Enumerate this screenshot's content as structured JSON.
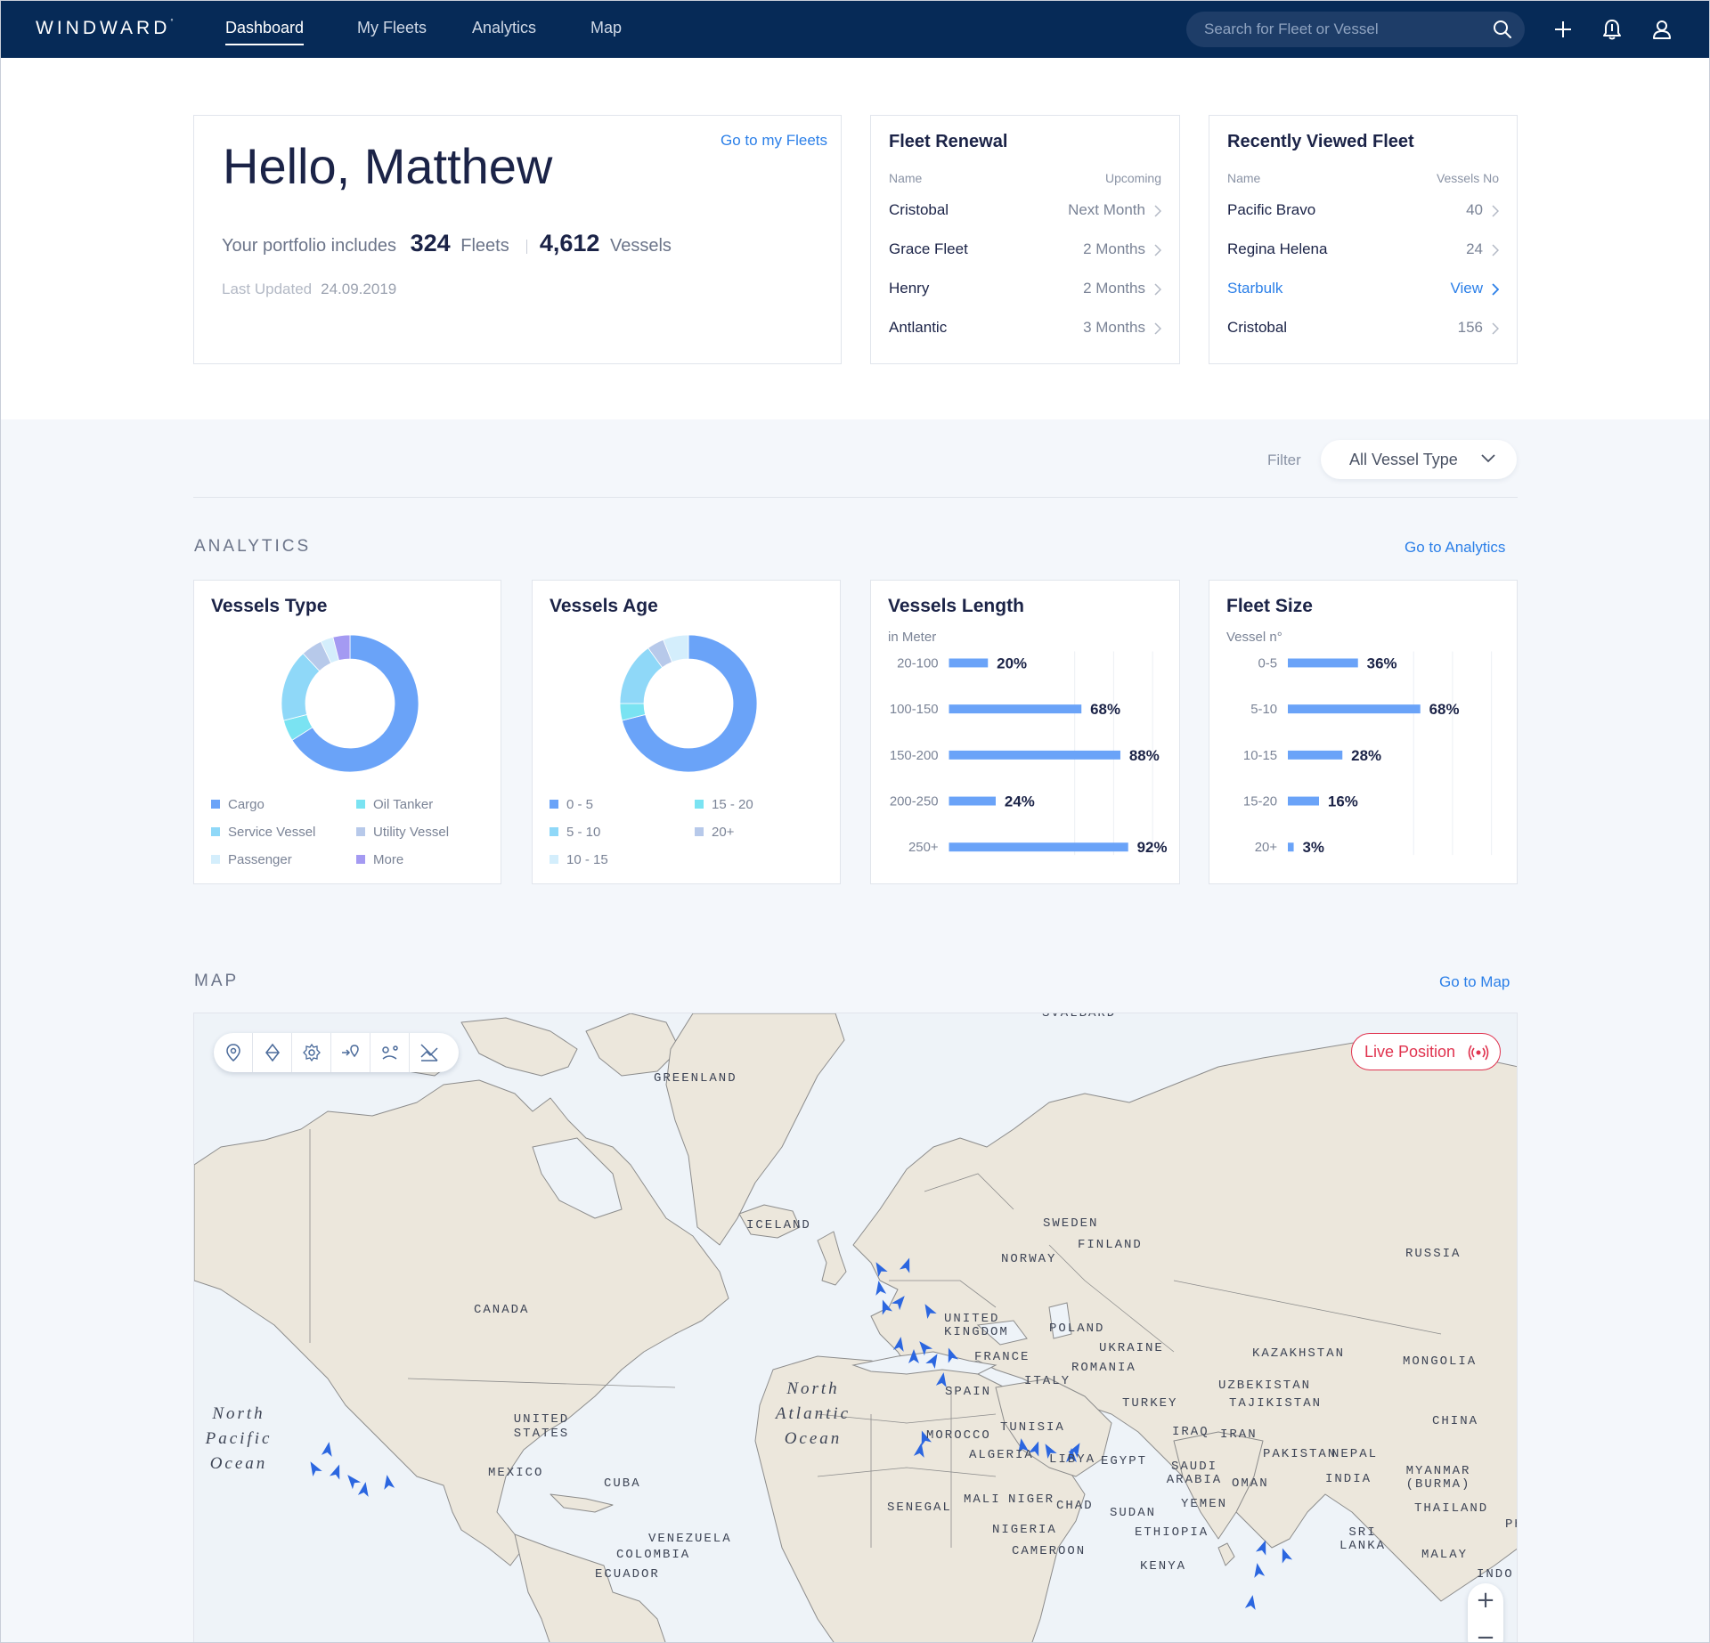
{
  "nav": {
    "brand": "WINDWARD",
    "brand_mark": "°",
    "links": [
      "Dashboard",
      "My Fleets",
      "Analytics",
      "Map"
    ],
    "active": "Dashboard",
    "search_placeholder": "Search for Fleet or Vessel",
    "icons": [
      "search-icon",
      "plus-icon",
      "bell-icon",
      "user-icon"
    ]
  },
  "hello": {
    "greeting": "Hello, Matthew",
    "go_link": "Go to my Fleets",
    "portfolio_prefix": "Your portfolio includes",
    "fleets_count": "324",
    "fleets_label": "Fleets",
    "vessels_count": "4,612",
    "vessels_label": "Vessels",
    "updated_label": "Last Updated",
    "updated_date": "24.09.2019"
  },
  "renewal": {
    "title": "Fleet Renewal",
    "col_name": "Name",
    "col_value": "Upcoming",
    "rows": [
      {
        "name": "Cristobal",
        "value": "Next Month"
      },
      {
        "name": "Grace Fleet",
        "value": "2 Months"
      },
      {
        "name": "Henry",
        "value": "2 Months"
      },
      {
        "name": "Antlantic",
        "value": "3 Months"
      }
    ]
  },
  "recent": {
    "title": "Recently Viewed Fleet",
    "col_name": "Name",
    "col_value": "Vessels No",
    "rows": [
      {
        "name": "Pacific Bravo",
        "value": "40"
      },
      {
        "name": "Regina Helena",
        "value": "24"
      },
      {
        "name": "Starbulk",
        "value": "View"
      },
      {
        "name": "Cristobal",
        "value": "156"
      }
    ]
  },
  "filter": {
    "label": "Filter",
    "value": "All Vessel Type"
  },
  "analytics": {
    "section_title": "ANALYTICS",
    "go_link": "Go to Analytics",
    "vessels_type": {
      "title": "Vessels Type"
    },
    "vessels_age": {
      "title": "Vessels Age"
    },
    "vessels_length": {
      "title": "Vessels Length",
      "subtitle": "in Meter"
    },
    "fleet_size": {
      "title": "Fleet Size",
      "subtitle": "Vessel n°"
    }
  },
  "chart_data": [
    {
      "type": "pie",
      "title": "Vessels Type",
      "categories": [
        "Cargo",
        "Oil Tanker",
        "Service Vessel",
        "Utility Vessel",
        "Passenger",
        "More"
      ],
      "values": [
        66,
        5,
        17,
        5,
        3,
        4
      ],
      "colors": [
        "#6aa3f8",
        "#7ae3f2",
        "#8fd8f8",
        "#b7c9ea",
        "#d4eefc",
        "#a49af2"
      ],
      "legend": "bottom"
    },
    {
      "type": "pie",
      "title": "Vessels Age",
      "categories": [
        "0 - 5",
        "15 - 20",
        "5 - 10",
        "20+",
        "10 - 15"
      ],
      "values": [
        71,
        4,
        15,
        4,
        6
      ],
      "colors": [
        "#6aa3f8",
        "#7ae3f2",
        "#8fd8f8",
        "#b7c9ea",
        "#d4eefc"
      ],
      "legend": "bottom"
    },
    {
      "type": "bar",
      "title": "Vessels Length",
      "subtitle": "in Meter",
      "orientation": "horizontal",
      "categories": [
        "20-100",
        "100-150",
        "150-200",
        "200-250",
        "250+"
      ],
      "values": [
        20,
        68,
        88,
        24,
        92
      ],
      "value_labels": [
        "20%",
        "68%",
        "88%",
        "24%",
        "92%"
      ],
      "xlim": [
        0,
        100
      ],
      "color": "#6aa3f8",
      "grid": true
    },
    {
      "type": "bar",
      "title": "Fleet Size",
      "subtitle": "Vessel n°",
      "orientation": "horizontal",
      "categories": [
        "0-5",
        "5-10",
        "10-15",
        "15-20",
        "20+"
      ],
      "values": [
        36,
        68,
        28,
        16,
        3
      ],
      "value_labels": [
        "36%",
        "68%",
        "28%",
        "16%",
        "3%"
      ],
      "xlim": [
        0,
        100
      ],
      "color": "#6aa3f8",
      "grid": true
    }
  ],
  "map": {
    "section_title": "MAP",
    "go_link": "Go to Map",
    "live_label": "Live Position",
    "tools": [
      "location-pin-icon",
      "ship-icon",
      "settings-gear-icon",
      "route-arrow-icon",
      "path-icon",
      "chart-off-icon"
    ],
    "zoom_in": "+",
    "zoom_out": "−",
    "labels": [
      "GREENLAND",
      "ICELAND",
      "SWEDEN",
      "FINLAND",
      "NORWAY",
      "RUSSIA",
      "UNITED KINGDOM",
      "POLAND",
      "UKRAINE",
      "FRANCE",
      "ROMANIA",
      "KAZAKHSTAN",
      "MONGOLIA",
      "CANADA",
      "UNITED STATES",
      "SPAIN",
      "ITALY",
      "TURKEY",
      "UZBEKISTAN",
      "TAJIKISTAN",
      "CHINA",
      "TUNISIA",
      "MOROCCO",
      "IRAQ",
      "IRAN",
      "ALGERIA",
      "LIBYA",
      "EGYPT",
      "PAKISTAN",
      "NEPAL",
      "SAUDI ARABIA",
      "OMAN",
      "INDIA",
      "MYANMAR (BURMA)",
      "MEXICO",
      "CUBA",
      "MALI",
      "NIGER",
      "CHAD",
      "SUDAN",
      "YEMEN",
      "THAILAND",
      "SENEGAL",
      "NIGERIA",
      "ETHIOPIA",
      "SRI LANKA",
      "VENEZUELA",
      "COLOMBIA",
      "CAMEROON",
      "KENYA",
      "ECUADOR",
      "MALAY",
      "PH",
      "INDO",
      "SVALBARD"
    ],
    "oceans": [
      "North Pacific Ocean",
      "North Atlantic Ocean"
    ]
  }
}
